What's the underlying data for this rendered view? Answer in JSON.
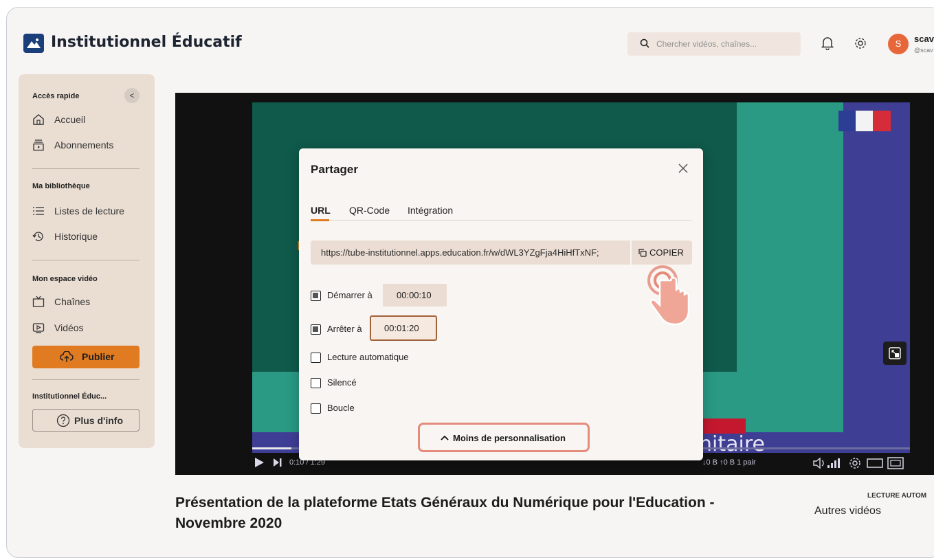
{
  "header": {
    "brand": "Institutionnel Éducatif",
    "search_placeholder": "Chercher vidéos, chaînes...",
    "avatar_initial": "S",
    "user_name": "scav",
    "user_handle": "@scav"
  },
  "sidebar": {
    "quick_access_title": "Accès rapide",
    "collapse_icon": "<",
    "items_quick": [
      {
        "label": "Accueil",
        "icon": "home-icon"
      },
      {
        "label": "Abonnements",
        "icon": "subscriptions-icon"
      }
    ],
    "library_title": "Ma bibliothèque",
    "items_library": [
      {
        "label": "Listes de lecture",
        "icon": "list-icon"
      },
      {
        "label": "Historique",
        "icon": "history-icon"
      }
    ],
    "space_title": "Mon espace vidéo",
    "items_space": [
      {
        "label": "Chaînes",
        "icon": "tv-icon"
      },
      {
        "label": "Vidéos",
        "icon": "video-icon"
      }
    ],
    "publish_label": "Publier",
    "instance_title": "Institutionnel Éduc...",
    "more_info_label": "Plus d'info"
  },
  "player": {
    "time": "0:10 / 1:29",
    "stats": "↓0 B  ↑0 B  1 pair",
    "slide_text": "nitaire",
    "progress": 0.06
  },
  "share_modal": {
    "title": "Partager",
    "tabs": [
      {
        "label": "URL",
        "active": true
      },
      {
        "label": "QR-Code",
        "active": false
      },
      {
        "label": "Intégration",
        "active": false
      }
    ],
    "url": "https://tube-institutionnel.apps.education.fr/w/dWL3YZgFja4HiHfTxNF;",
    "copy_label": "COPIER",
    "start": {
      "label": "Démarrer à",
      "value": "00:00:10",
      "checked": true
    },
    "stop": {
      "label": "Arrêter à",
      "value": "00:01:20",
      "checked": true
    },
    "options": [
      {
        "label": "Lecture automatique",
        "checked": false
      },
      {
        "label": "Silencé",
        "checked": false
      },
      {
        "label": "Boucle",
        "checked": false
      }
    ],
    "less_label": "Moins de personnalisation"
  },
  "video": {
    "title": "Présentation de la plateforme Etats Généraux du Numérique pour l'Education - Novembre 2020",
    "autoplay_label": "LECTURE AUTOM",
    "others_label": "Autres vidéos"
  },
  "colors": {
    "accent": "#e07b22",
    "highlight": "#e58b7c"
  }
}
